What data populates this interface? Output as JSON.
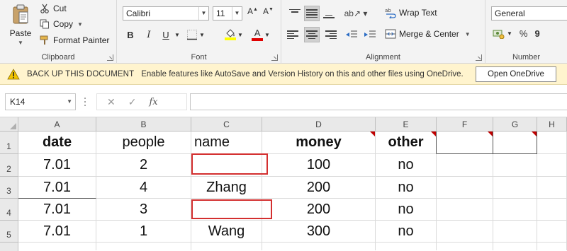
{
  "ribbon": {
    "clipboard": {
      "paste_label": "Paste",
      "cut_label": "Cut",
      "copy_label": "Copy",
      "format_painter_label": "Format Painter",
      "group_label": "Clipboard"
    },
    "font": {
      "font_name": "Calibri",
      "font_size": "11",
      "bold": "B",
      "italic": "I",
      "underline": "U",
      "font_color_letter": "A",
      "fill_color": "#ffff00",
      "font_color": "#e00000",
      "group_label": "Font"
    },
    "alignment": {
      "wrap_text_label": "Wrap Text",
      "merge_center_label": "Merge & Center",
      "group_label": "Alignment"
    },
    "number": {
      "format": "General",
      "percent": "%",
      "comma": "9",
      "group_label": "Number"
    }
  },
  "message_bar": {
    "title": "BACK UP THIS DOCUMENT",
    "text": "Enable features like AutoSave and Version History on this and other files using OneDrive.",
    "button_label": "Open OneDrive"
  },
  "formula_bar": {
    "name_box": "K14",
    "cancel": "✕",
    "enter": "✓",
    "fx": "fx",
    "formula": ""
  },
  "sheet": {
    "columns": [
      "A",
      "B",
      "C",
      "D",
      "E",
      "F",
      "G",
      "H"
    ],
    "rows": [
      "1",
      "2",
      "3",
      "4",
      "5"
    ],
    "cells": [
      [
        "date",
        "people",
        "name",
        "money",
        "other",
        "",
        ""
      ],
      [
        "7.01",
        "2",
        "",
        "100",
        "no",
        "",
        ""
      ],
      [
        "7.01",
        "4",
        "Zhang",
        "200",
        "no",
        "",
        ""
      ],
      [
        "7.01",
        "3",
        "",
        "200",
        "no",
        "",
        ""
      ],
      [
        "7.01",
        "1",
        "Wang",
        "300",
        "no",
        "",
        ""
      ]
    ],
    "highlight_color": "#d32f2f",
    "comment_indicator_color": "#c00000"
  }
}
